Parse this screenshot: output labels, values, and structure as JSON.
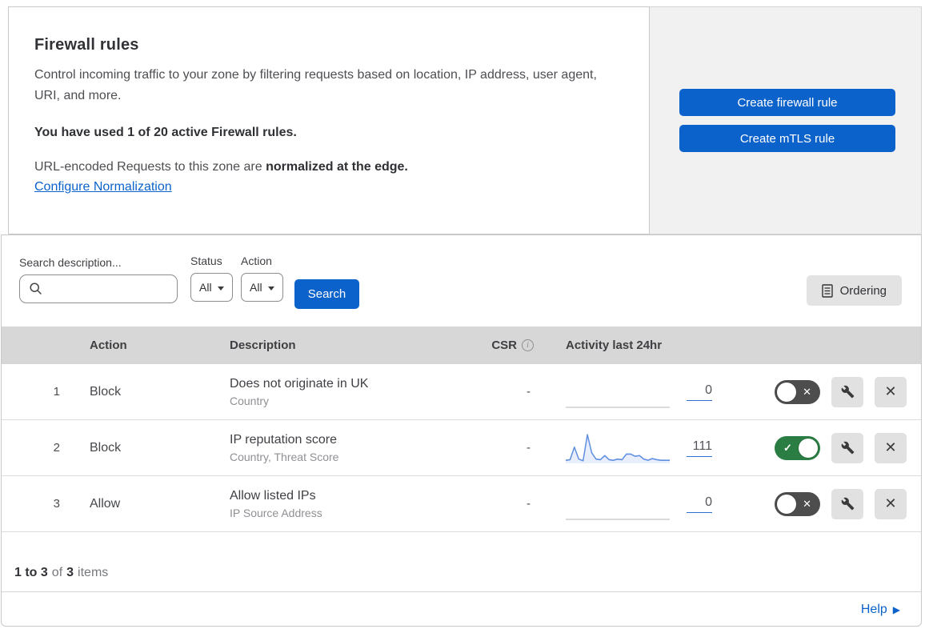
{
  "colors": {
    "accent": "#0b62ca",
    "toggle_on": "#2a7e43",
    "toggle_off": "#4d4d4d",
    "sparkline_stroke": "#5e8fe0",
    "sparkline_fill": "rgba(110,150,230,0.16)",
    "flat_line": "#c3c3c3",
    "table_header_bg": "#d7d7d7",
    "panel_bg": "#f1f1f1"
  },
  "icons": {
    "search": "magnifier",
    "ordering": "document-list",
    "info": "circled-i",
    "wrench": "wrench",
    "close": "x-mark",
    "toggle_on_glyph": "✓",
    "toggle_off_glyph": "✕",
    "help_arrow": "▶",
    "dropdown_caret": "triangle-down"
  },
  "header": {
    "title": "Firewall rules",
    "description": "Control incoming traffic to your zone by filtering requests based on location, IP address, user agent, URI, and more.",
    "usage": "You have used 1 of 20 active Firewall rules.",
    "normalization_prefix": "URL-encoded Requests to this zone are ",
    "normalization_bold": "normalized at the edge.",
    "normalization_link": "Configure Normalization",
    "buttons": {
      "create_firewall": "Create firewall rule",
      "create_mtls": "Create mTLS rule"
    }
  },
  "filters": {
    "search_label": "Search description...",
    "search_value": "",
    "status_label": "Status",
    "status_value": "All",
    "action_label": "Action",
    "action_value": "All",
    "search_button": "Search",
    "ordering_button": "Ordering"
  },
  "table": {
    "columns": {
      "action": "Action",
      "description": "Description",
      "csr": "CSR",
      "activity": "Activity last 24hr"
    },
    "rows": [
      {
        "index": "1",
        "action": "Block",
        "description": "Does not originate in UK",
        "fields": "Country",
        "csr": "-",
        "count": "0",
        "enabled": false,
        "sparkline": []
      },
      {
        "index": "2",
        "action": "Block",
        "description": "IP reputation score",
        "fields": "Country, Threat Score",
        "csr": "-",
        "count": "111",
        "enabled": true,
        "sparkline": [
          8,
          10,
          55,
          12,
          6,
          100,
          35,
          12,
          10,
          25,
          10,
          8,
          12,
          10,
          30,
          30,
          22,
          25,
          12,
          8,
          14,
          10,
          8,
          8,
          8
        ]
      },
      {
        "index": "3",
        "action": "Allow",
        "description": "Allow listed IPs",
        "fields": "IP Source Address",
        "csr": "-",
        "count": "0",
        "enabled": false,
        "sparkline": []
      }
    ]
  },
  "footer": {
    "range_bold": "1 to 3",
    "of_text": "of",
    "total_bold": "3",
    "items_text": "items",
    "help_label": "Help"
  }
}
